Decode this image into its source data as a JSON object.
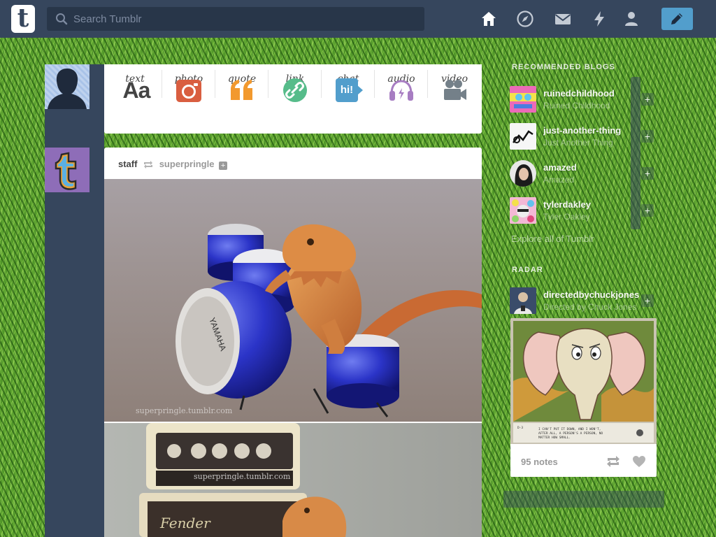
{
  "header": {
    "search_placeholder": "Search Tumblr",
    "logo_letter": "t",
    "nav": [
      "home-icon",
      "explore-icon",
      "inbox-icon",
      "activity-icon",
      "account-icon"
    ],
    "compose": "compose-icon"
  },
  "post_types": [
    {
      "label": "text",
      "icon": "Aa"
    },
    {
      "label": "photo",
      "icon": "camera-icon",
      "color": "#d95e40"
    },
    {
      "label": "quote",
      "icon": "quote-icon",
      "color": "#f2992e"
    },
    {
      "label": "link",
      "icon": "link-icon",
      "color": "#56bc8a"
    },
    {
      "label": "chat",
      "icon": "hi!",
      "color": "#529ecc"
    },
    {
      "label": "audio",
      "icon": "headphones-icon",
      "color": "#a77dc2"
    },
    {
      "label": "video",
      "icon": "video-camera-icon",
      "color": "#748089"
    }
  ],
  "post": {
    "author": "staff",
    "source": "superpringle",
    "follow": "+",
    "watermark": "superpringle.tumblr.com"
  },
  "sidebar": {
    "title": "Recommended Blogs",
    "blogs": [
      {
        "name": "ruinedchildhood",
        "sub": "Ruined Childhood"
      },
      {
        "name": "just-another-thing",
        "sub": "Just Another Thing"
      },
      {
        "name": "amazed",
        "sub": "Amazed"
      },
      {
        "name": "tylerdakley",
        "sub": "Tyler Oakley"
      }
    ],
    "explore": "Explore all of Tumblr",
    "radar_title": "Radar",
    "radar_blog": {
      "name": "directedbychuckjones",
      "sub": "Directed by Chuck Jones"
    },
    "radar_caption": "I CAN'T PUT IT DOWN, AND I WON'T, AFTER ALL, A PERSON'S A PERSON, NO MATTER HOW SMALL.",
    "notes": "95 notes"
  },
  "colors": {
    "header": "#36465d",
    "accent": "#529ecc",
    "grass": "#5fa431"
  }
}
